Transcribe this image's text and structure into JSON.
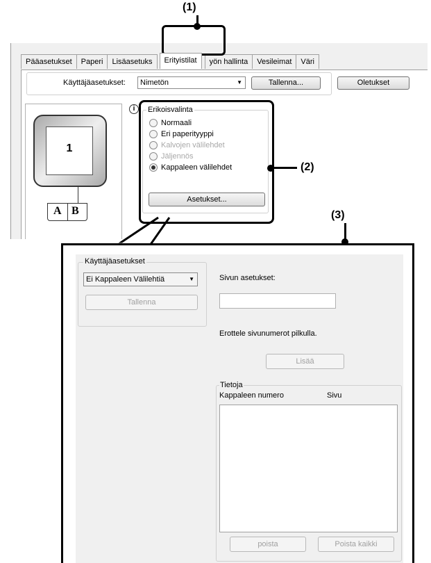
{
  "callouts": {
    "one": "(1)",
    "two": "(2)",
    "three": "(3)"
  },
  "tabs": [
    "Pääasetukset",
    "Paperi",
    "Lisäasetuks",
    "Erityistilat",
    "yön hallinta",
    "Vesileimat",
    "Väri"
  ],
  "top": {
    "user_settings_label": "Käyttäjäasetukset:",
    "user_settings_value": "Nimetön",
    "save_label": "Tallenna...",
    "defaults_label": "Oletukset",
    "preview_page_number": "1",
    "preview_letters": [
      "A",
      "B"
    ],
    "info_icon": "i",
    "group_title": "Erikoisvalinta",
    "options": [
      "Normaali",
      "Eri paperityyppi",
      "Kalvojen välilehdet",
      "Jäljennös",
      "Kappaleen välilehdet"
    ],
    "selected_option": "Kappaleen välilehdet",
    "settings_button": "Asetukset..."
  },
  "bottom": {
    "group_title": "Käyttäjäasetukset",
    "dropdown_value": "Ei Kappaleen Välilehtiä",
    "save_label": "Tallenna",
    "page_settings_label": "Sivun asetukset:",
    "page_settings_value": "",
    "hint": "Erottele sivunumerot pilkulla.",
    "add_label": "Lisää",
    "info_title": "Tietoja",
    "col_chapter": "Kappaleen numero",
    "col_page": "Sivu",
    "delete_label": "poista",
    "delete_all_label": "Poista kaikki"
  }
}
